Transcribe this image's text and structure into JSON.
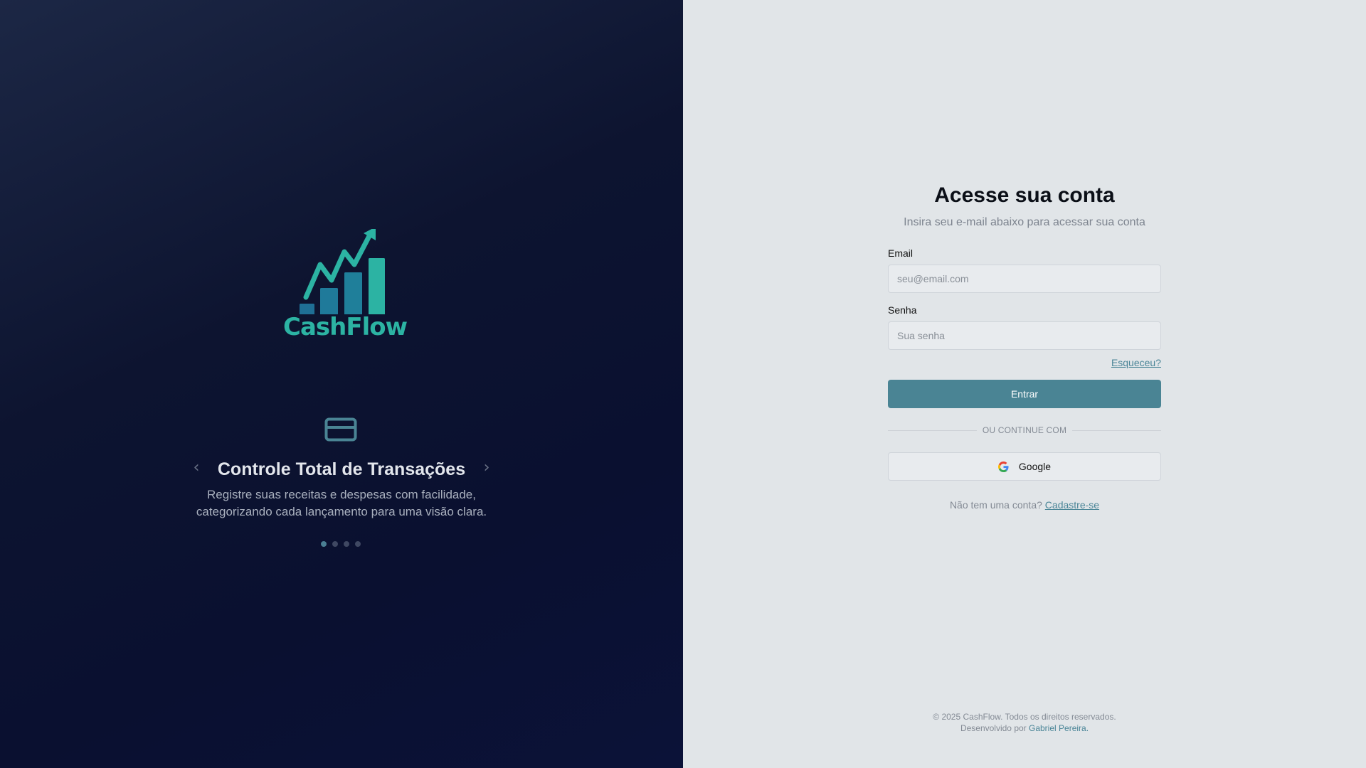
{
  "brand": {
    "name": "CashFlow",
    "logo_icon": "bar-chart-growth-icon",
    "accent": "#2cb3a3"
  },
  "carousel": {
    "icon": "credit-card-icon",
    "title": "Controle Total de Transações",
    "description": "Registre suas receitas e despesas com facilidade, categorizando cada lançamento para uma visão clara.",
    "prev_label": "‹",
    "next_label": "›",
    "slide_count": 4,
    "active_index": 0
  },
  "login": {
    "title": "Acesse sua conta",
    "subtitle": "Insira seu e-mail abaixo para acessar sua conta",
    "email_label": "Email",
    "email_placeholder": "seu@email.com",
    "password_label": "Senha",
    "password_placeholder": "Sua senha",
    "forgot_label": "Esqueceu?",
    "submit_label": "Entrar",
    "divider_label": "OU CONTINUE COM",
    "google_label": "Google",
    "signup_prompt": "Não tem uma conta?",
    "signup_link": "Cadastre-se"
  },
  "footer": {
    "copyright": "© 2025 CashFlow. Todos os direitos reservados.",
    "developed_by": "Desenvolvido por",
    "developer": "Gabriel Pereira."
  },
  "colors": {
    "primary_button": "#4a8494",
    "link": "#4a8597",
    "left_bg": "#0d1430",
    "right_bg": "#e1e5e8"
  }
}
